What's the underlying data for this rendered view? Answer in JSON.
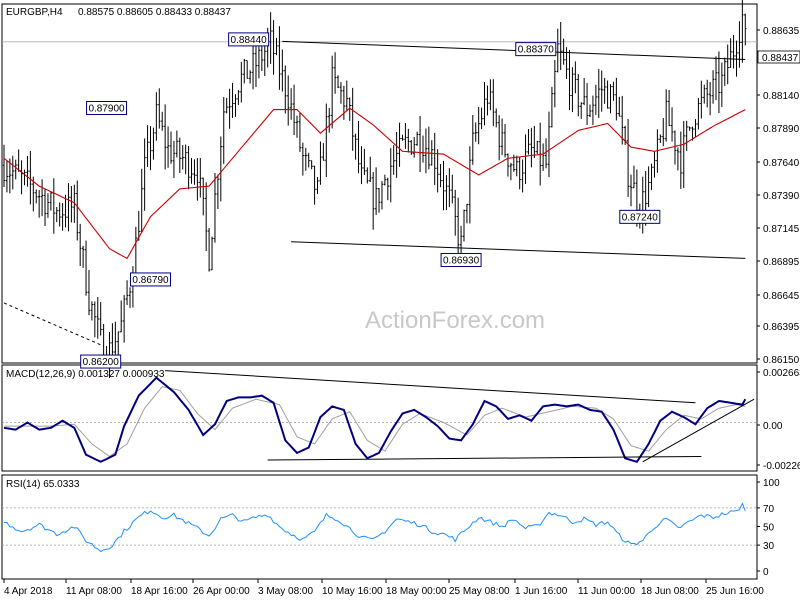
{
  "header": {
    "symbol": "EURGBP,H4",
    "ohlc": "0.88575 0.88605 0.88433 0.88437",
    "macd_label": "MACD(12,26,9) 0.001327 0.000933",
    "rsi_label": "RSI(14) 65.0333",
    "watermark": "ActionForex.com"
  },
  "colors": {
    "price": "#000000",
    "ma": "#cc0000",
    "macd": "#000080",
    "signal": "#a0a0a0",
    "rsi": "#1e90ff",
    "label_box": "#000080",
    "grid": "#cccccc"
  },
  "chart_data": [
    {
      "type": "ohlc",
      "title": "EURGBP,H4",
      "ylim": [
        0.8615,
        0.8868
      ],
      "y_ticks": [
        "0.88635",
        "0.88437",
        "0.88140",
        "0.87890",
        "0.87640",
        "0.87390",
        "0.87145",
        "0.86895",
        "0.86645",
        "0.86395",
        "0.86150"
      ],
      "last_price": "0.88437",
      "x_ticks": [
        "4 Apr 2018",
        "11 Apr 08:00",
        "18 Apr 16:00",
        "26 Apr 00:00",
        "3 May 08:00",
        "10 May 16:00",
        "18 May 00:00",
        "25 May 08:00",
        "1 Jun 16:00",
        "11 Jun 00:00",
        "18 Jun 08:00",
        "25 Jun 16:00"
      ],
      "anchors": [
        {
          "i": 0,
          "v": 0.8755
        },
        {
          "i": 10,
          "v": 0.8738
        },
        {
          "i": 18,
          "v": 0.8722
        },
        {
          "i": 24,
          "v": 0.8725
        },
        {
          "i": 29,
          "v": 0.866
        },
        {
          "i": 33,
          "v": 0.8628
        },
        {
          "i": 36,
          "v": 0.8622
        },
        {
          "i": 40,
          "v": 0.864
        },
        {
          "i": 44,
          "v": 0.868
        },
        {
          "i": 48,
          "v": 0.8752
        },
        {
          "i": 52,
          "v": 0.879
        },
        {
          "i": 56,
          "v": 0.8766
        },
        {
          "i": 61,
          "v": 0.876
        },
        {
          "i": 66,
          "v": 0.8752
        },
        {
          "i": 70,
          "v": 0.869
        },
        {
          "i": 75,
          "v": 0.8795
        },
        {
          "i": 80,
          "v": 0.8815
        },
        {
          "i": 86,
          "v": 0.8828
        },
        {
          "i": 91,
          "v": 0.8843
        },
        {
          "i": 97,
          "v": 0.8805
        },
        {
          "i": 102,
          "v": 0.876
        },
        {
          "i": 107,
          "v": 0.8735
        },
        {
          "i": 112,
          "v": 0.8815
        },
        {
          "i": 117,
          "v": 0.88
        },
        {
          "i": 122,
          "v": 0.8745
        },
        {
          "i": 127,
          "v": 0.873
        },
        {
          "i": 132,
          "v": 0.8755
        },
        {
          "i": 137,
          "v": 0.877
        },
        {
          "i": 142,
          "v": 0.8775
        },
        {
          "i": 147,
          "v": 0.876
        },
        {
          "i": 152,
          "v": 0.873
        },
        {
          "i": 156,
          "v": 0.8697
        },
        {
          "i": 160,
          "v": 0.877
        },
        {
          "i": 165,
          "v": 0.8805
        },
        {
          "i": 170,
          "v": 0.877
        },
        {
          "i": 175,
          "v": 0.875
        },
        {
          "i": 180,
          "v": 0.8765
        },
        {
          "i": 185,
          "v": 0.8755
        },
        {
          "i": 189,
          "v": 0.8838
        },
        {
          "i": 194,
          "v": 0.881
        },
        {
          "i": 199,
          "v": 0.8795
        },
        {
          "i": 204,
          "v": 0.881
        },
        {
          "i": 209,
          "v": 0.88
        },
        {
          "i": 213,
          "v": 0.875
        },
        {
          "i": 217,
          "v": 0.8725
        },
        {
          "i": 221,
          "v": 0.8745
        },
        {
          "i": 226,
          "v": 0.879
        },
        {
          "i": 231,
          "v": 0.876
        },
        {
          "i": 235,
          "v": 0.879
        },
        {
          "i": 240,
          "v": 0.8805
        },
        {
          "i": 245,
          "v": 0.8815
        },
        {
          "i": 249,
          "v": 0.8838
        },
        {
          "i": 252,
          "v": 0.8862
        },
        {
          "i": 253,
          "v": 0.8844
        }
      ],
      "ma_anchors": [
        {
          "i": 0,
          "v": 0.876
        },
        {
          "i": 12,
          "v": 0.874
        },
        {
          "i": 24,
          "v": 0.8728
        },
        {
          "i": 36,
          "v": 0.8695
        },
        {
          "i": 42,
          "v": 0.8688
        },
        {
          "i": 50,
          "v": 0.8718
        },
        {
          "i": 60,
          "v": 0.8738
        },
        {
          "i": 70,
          "v": 0.874
        },
        {
          "i": 82,
          "v": 0.877
        },
        {
          "i": 92,
          "v": 0.8795
        },
        {
          "i": 100,
          "v": 0.8795
        },
        {
          "i": 108,
          "v": 0.8778
        },
        {
          "i": 118,
          "v": 0.8796
        },
        {
          "i": 126,
          "v": 0.8784
        },
        {
          "i": 136,
          "v": 0.8765
        },
        {
          "i": 150,
          "v": 0.8763
        },
        {
          "i": 162,
          "v": 0.8748
        },
        {
          "i": 172,
          "v": 0.876
        },
        {
          "i": 184,
          "v": 0.8763
        },
        {
          "i": 196,
          "v": 0.878
        },
        {
          "i": 206,
          "v": 0.8785
        },
        {
          "i": 214,
          "v": 0.8768
        },
        {
          "i": 222,
          "v": 0.8765
        },
        {
          "i": 232,
          "v": 0.877
        },
        {
          "i": 242,
          "v": 0.8783
        },
        {
          "i": 253,
          "v": 0.8795
        }
      ],
      "annotations": [
        {
          "text": "0.86200",
          "i": 33,
          "v": 0.862,
          "pos": "below"
        },
        {
          "text": "0.86790",
          "i": 50,
          "v": 0.8679,
          "pos": "below"
        },
        {
          "text": "0.87900",
          "i": 35,
          "v": 0.879,
          "pos": "above"
        },
        {
          "text": "0.88440",
          "i": 91,
          "v": 0.8844,
          "pos": "above-left"
        },
        {
          "text": "0.86930",
          "i": 156,
          "v": 0.8693,
          "pos": "below"
        },
        {
          "text": "0.88370",
          "i": 189,
          "v": 0.8837,
          "pos": "above-left"
        },
        {
          "text": "0.87240",
          "i": 217,
          "v": 0.8724,
          "pos": "below"
        }
      ],
      "trendlines": [
        {
          "i1": 95,
          "v1": 0.8844,
          "i2": 253,
          "v2": 0.8831,
          "style": "solid"
        },
        {
          "i1": 98,
          "v1": 0.87,
          "i2": 253,
          "v2": 0.8688,
          "style": "solid"
        },
        {
          "i1": 0,
          "v1": 0.8656,
          "i2": 34,
          "v2": 0.8625,
          "style": "dashed"
        }
      ]
    },
    {
      "type": "line",
      "title": "MACD(12,26,9) 0.001327 0.000933",
      "ylim": [
        -0.0026,
        0.0031
      ],
      "y_ticks": [
        "0.002663",
        "0.00",
        "-0.00226"
      ],
      "macd_anchors": [
        {
          "i": 0,
          "v": -0.0003
        },
        {
          "i": 4,
          "v": -0.0004
        },
        {
          "i": 8,
          "v": 0.0
        },
        {
          "i": 12,
          "v": -0.0004
        },
        {
          "i": 16,
          "v": -0.0003
        },
        {
          "i": 20,
          "v": 0.0001
        },
        {
          "i": 24,
          "v": -0.0003
        },
        {
          "i": 28,
          "v": -0.0018
        },
        {
          "i": 33,
          "v": -0.0022
        },
        {
          "i": 38,
          "v": -0.0018
        },
        {
          "i": 41,
          "v": -0.0002
        },
        {
          "i": 46,
          "v": 0.0015
        },
        {
          "i": 52,
          "v": 0.0025
        },
        {
          "i": 58,
          "v": 0.0017
        },
        {
          "i": 63,
          "v": 0.0007
        },
        {
          "i": 68,
          "v": -0.0007
        },
        {
          "i": 72,
          "v": -0.0001
        },
        {
          "i": 76,
          "v": 0.0012
        },
        {
          "i": 80,
          "v": 0.0014
        },
        {
          "i": 84,
          "v": 0.0014
        },
        {
          "i": 88,
          "v": 0.0015
        },
        {
          "i": 92,
          "v": 0.0011
        },
        {
          "i": 96,
          "v": -0.001
        },
        {
          "i": 100,
          "v": -0.0017
        },
        {
          "i": 104,
          "v": -0.0014
        },
        {
          "i": 108,
          "v": 0.0003
        },
        {
          "i": 112,
          "v": 0.0009
        },
        {
          "i": 116,
          "v": 0.0007
        },
        {
          "i": 120,
          "v": -0.0012
        },
        {
          "i": 124,
          "v": -0.002
        },
        {
          "i": 128,
          "v": -0.0017
        },
        {
          "i": 132,
          "v": -0.0005
        },
        {
          "i": 136,
          "v": 0.0005
        },
        {
          "i": 140,
          "v": 0.0007
        },
        {
          "i": 144,
          "v": 0.0003
        },
        {
          "i": 148,
          "v": -0.0002
        },
        {
          "i": 152,
          "v": -0.0009
        },
        {
          "i": 156,
          "v": -0.001
        },
        {
          "i": 160,
          "v": -0.0001
        },
        {
          "i": 164,
          "v": 0.0012
        },
        {
          "i": 168,
          "v": 0.0009
        },
        {
          "i": 172,
          "v": 0.0002
        },
        {
          "i": 176,
          "v": 0.0004
        },
        {
          "i": 180,
          "v": 0.0001
        },
        {
          "i": 184,
          "v": 0.0009
        },
        {
          "i": 188,
          "v": 0.001
        },
        {
          "i": 192,
          "v": 0.0009
        },
        {
          "i": 196,
          "v": 0.001
        },
        {
          "i": 200,
          "v": 0.0007
        },
        {
          "i": 204,
          "v": 0.0006
        },
        {
          "i": 208,
          "v": -0.0004
        },
        {
          "i": 212,
          "v": -0.002
        },
        {
          "i": 216,
          "v": -0.0022
        },
        {
          "i": 220,
          "v": -0.0012
        },
        {
          "i": 224,
          "v": 0.0001
        },
        {
          "i": 228,
          "v": 0.0006
        },
        {
          "i": 232,
          "v": 0.0003
        },
        {
          "i": 236,
          "v": -0.0001
        },
        {
          "i": 240,
          "v": 0.0008
        },
        {
          "i": 244,
          "v": 0.0012
        },
        {
          "i": 248,
          "v": 0.0011
        },
        {
          "i": 252,
          "v": 0.001
        },
        {
          "i": 253,
          "v": 0.0013
        }
      ],
      "signal_anchors": [
        {
          "i": 0,
          "v": -0.0002
        },
        {
          "i": 8,
          "v": -0.0002
        },
        {
          "i": 16,
          "v": -0.0002
        },
        {
          "i": 24,
          "v": -0.0001
        },
        {
          "i": 30,
          "v": -0.0012
        },
        {
          "i": 36,
          "v": -0.0019
        },
        {
          "i": 42,
          "v": -0.0012
        },
        {
          "i": 48,
          "v": 0.0008
        },
        {
          "i": 54,
          "v": 0.002
        },
        {
          "i": 60,
          "v": 0.0018
        },
        {
          "i": 66,
          "v": 0.0005
        },
        {
          "i": 72,
          "v": -0.0004
        },
        {
          "i": 78,
          "v": 0.0008
        },
        {
          "i": 86,
          "v": 0.0013
        },
        {
          "i": 94,
          "v": 0.001
        },
        {
          "i": 100,
          "v": -0.0008
        },
        {
          "i": 106,
          "v": -0.0012
        },
        {
          "i": 112,
          "v": 0.0002
        },
        {
          "i": 118,
          "v": 0.0006
        },
        {
          "i": 124,
          "v": -0.001
        },
        {
          "i": 130,
          "v": -0.0016
        },
        {
          "i": 136,
          "v": -0.0001
        },
        {
          "i": 142,
          "v": 0.0005
        },
        {
          "i": 150,
          "v": 0.0
        },
        {
          "i": 158,
          "v": -0.0007
        },
        {
          "i": 164,
          "v": 0.0004
        },
        {
          "i": 170,
          "v": 0.0008
        },
        {
          "i": 178,
          "v": 0.0003
        },
        {
          "i": 186,
          "v": 0.0006
        },
        {
          "i": 194,
          "v": 0.0009
        },
        {
          "i": 202,
          "v": 0.0008
        },
        {
          "i": 208,
          "v": 0.0002
        },
        {
          "i": 214,
          "v": -0.0013
        },
        {
          "i": 220,
          "v": -0.0016
        },
        {
          "i": 226,
          "v": -0.0004
        },
        {
          "i": 232,
          "v": 0.0004
        },
        {
          "i": 238,
          "v": 0.0002
        },
        {
          "i": 244,
          "v": 0.0008
        },
        {
          "i": 250,
          "v": 0.001
        },
        {
          "i": 253,
          "v": 0.0009
        }
      ],
      "trendlines": [
        {
          "i1": 55,
          "v1": 0.0029,
          "i2": 236,
          "v2": 0.0011
        },
        {
          "i1": 90,
          "v1": -0.0021,
          "i2": 238,
          "v2": -0.0019
        },
        {
          "i1": 218,
          "v1": -0.0022,
          "i2": 256,
          "v2": 0.0013
        }
      ]
    },
    {
      "type": "line",
      "title": "RSI(14) 65.0333",
      "ylim": [
        0,
        100
      ],
      "y_ticks": [
        "100",
        "70",
        "50",
        "30",
        "0"
      ],
      "levels": [
        70,
        30
      ],
      "rsi_anchors": [
        {
          "i": 0,
          "v": 55
        },
        {
          "i": 6,
          "v": 45
        },
        {
          "i": 12,
          "v": 52
        },
        {
          "i": 18,
          "v": 42
        },
        {
          "i": 24,
          "v": 50
        },
        {
          "i": 28,
          "v": 35
        },
        {
          "i": 33,
          "v": 24
        },
        {
          "i": 37,
          "v": 30
        },
        {
          "i": 41,
          "v": 45
        },
        {
          "i": 46,
          "v": 60
        },
        {
          "i": 50,
          "v": 68
        },
        {
          "i": 54,
          "v": 60
        },
        {
          "i": 58,
          "v": 62
        },
        {
          "i": 62,
          "v": 55
        },
        {
          "i": 66,
          "v": 48
        },
        {
          "i": 70,
          "v": 40
        },
        {
          "i": 74,
          "v": 58
        },
        {
          "i": 78,
          "v": 62
        },
        {
          "i": 82,
          "v": 55
        },
        {
          "i": 86,
          "v": 60
        },
        {
          "i": 90,
          "v": 63
        },
        {
          "i": 94,
          "v": 50
        },
        {
          "i": 98,
          "v": 42
        },
        {
          "i": 102,
          "v": 36
        },
        {
          "i": 106,
          "v": 44
        },
        {
          "i": 110,
          "v": 62
        },
        {
          "i": 114,
          "v": 58
        },
        {
          "i": 118,
          "v": 48
        },
        {
          "i": 122,
          "v": 38
        },
        {
          "i": 126,
          "v": 35
        },
        {
          "i": 130,
          "v": 45
        },
        {
          "i": 134,
          "v": 58
        },
        {
          "i": 138,
          "v": 55
        },
        {
          "i": 142,
          "v": 52
        },
        {
          "i": 146,
          "v": 45
        },
        {
          "i": 150,
          "v": 42
        },
        {
          "i": 154,
          "v": 36
        },
        {
          "i": 158,
          "v": 48
        },
        {
          "i": 162,
          "v": 60
        },
        {
          "i": 166,
          "v": 55
        },
        {
          "i": 170,
          "v": 50
        },
        {
          "i": 174,
          "v": 58
        },
        {
          "i": 178,
          "v": 48
        },
        {
          "i": 182,
          "v": 50
        },
        {
          "i": 186,
          "v": 65
        },
        {
          "i": 190,
          "v": 62
        },
        {
          "i": 194,
          "v": 55
        },
        {
          "i": 198,
          "v": 58
        },
        {
          "i": 202,
          "v": 52
        },
        {
          "i": 206,
          "v": 55
        },
        {
          "i": 210,
          "v": 40
        },
        {
          "i": 214,
          "v": 30
        },
        {
          "i": 218,
          "v": 35
        },
        {
          "i": 222,
          "v": 50
        },
        {
          "i": 226,
          "v": 58
        },
        {
          "i": 230,
          "v": 48
        },
        {
          "i": 234,
          "v": 55
        },
        {
          "i": 238,
          "v": 62
        },
        {
          "i": 242,
          "v": 60
        },
        {
          "i": 246,
          "v": 64
        },
        {
          "i": 250,
          "v": 66
        },
        {
          "i": 252,
          "v": 74
        },
        {
          "i": 253,
          "v": 65
        }
      ]
    }
  ]
}
